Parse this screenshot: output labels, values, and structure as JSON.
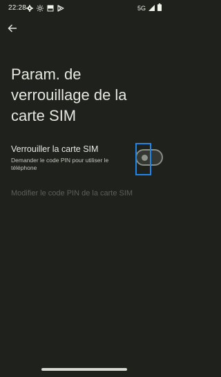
{
  "status_bar": {
    "time": "22:28",
    "network": "5G",
    "left_icons": [
      "settings-icon",
      "brightness-icon",
      "gallery-icon",
      "play-store-icon"
    ],
    "right_icons": [
      "signal-icon",
      "battery-icon"
    ]
  },
  "header": {
    "back_icon": "arrow-left-icon"
  },
  "page": {
    "title": "Param. de verrouillage de la carte SIM"
  },
  "settings": {
    "lock_sim": {
      "title": "Verrouiller la carte SIM",
      "summary": "Demander le code PIN pour utiliser le téléphone",
      "enabled": false
    },
    "change_pin": {
      "label": "Modifier le code PIN de la carte SIM",
      "disabled": true
    }
  },
  "colors": {
    "background": "#1f211d",
    "text_primary": "#e6e8e0",
    "text_secondary": "#c3c7bd",
    "text_disabled": "#5c6058",
    "highlight": "#1f86e8"
  }
}
